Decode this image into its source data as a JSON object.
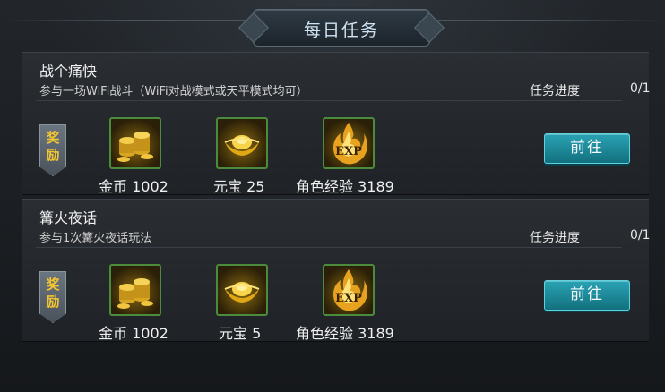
{
  "header": {
    "title": "每日任务"
  },
  "quests": [
    {
      "title": "战个痛快",
      "description": "参与一场WiFi战斗（WiFi对战模式或天平模式均可）",
      "progress_label": "任务进度",
      "progress_value": "0/1",
      "reward_tag": [
        "奖",
        "励"
      ],
      "rewards": [
        {
          "icon": "gold-coins-icon",
          "label": "金币 1002"
        },
        {
          "icon": "yuanbao-icon",
          "label": "元宝 25"
        },
        {
          "icon": "exp-icon",
          "label": "角色经验 3189"
        }
      ],
      "button_label": "前往"
    },
    {
      "title": "篝火夜话",
      "description": "参与1次篝火夜话玩法",
      "progress_label": "任务进度",
      "progress_value": "0/1",
      "reward_tag": [
        "奖",
        "励"
      ],
      "rewards": [
        {
          "icon": "gold-coins-icon",
          "label": "金币 1002"
        },
        {
          "icon": "yuanbao-icon",
          "label": "元宝 5"
        },
        {
          "icon": "exp-icon",
          "label": "角色经验 3189"
        }
      ],
      "button_label": "前往"
    }
  ],
  "colors": {
    "accent": "#1e8fa0",
    "reward_text": "#f3c530",
    "item_border": "#4c8a3c"
  }
}
